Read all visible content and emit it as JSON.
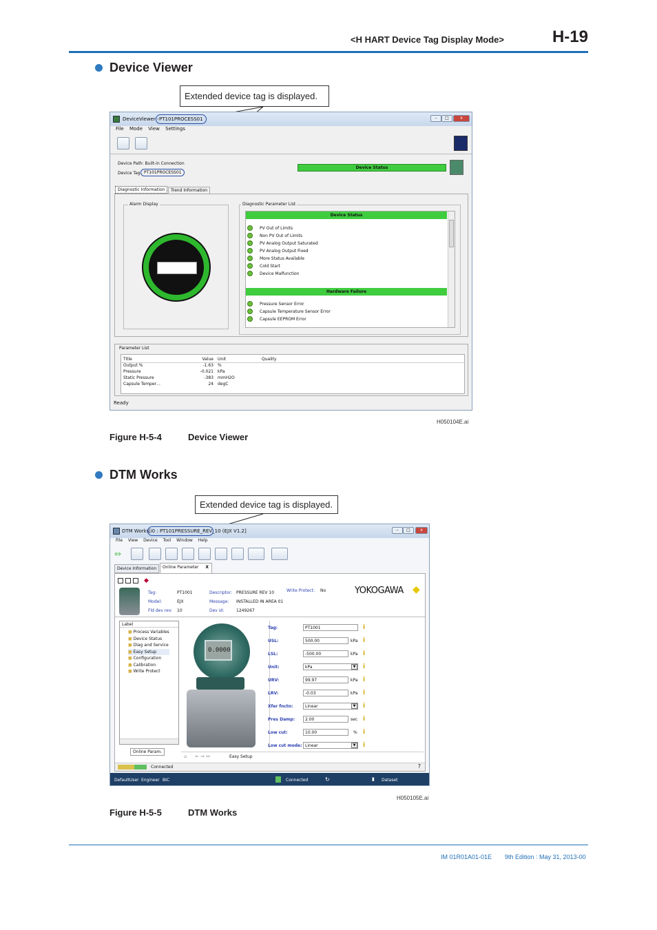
{
  "header": {
    "section": "<H  HART Device Tag Display Mode>",
    "page": "H-19"
  },
  "section1": {
    "title": "Device Viewer",
    "callout": "Extended device tag is displayed.",
    "figure_id": "H050104E.ai",
    "caption_num": "Figure H-5-4",
    "caption_title": "Device Viewer",
    "window": {
      "title_prefix": "DeviceViewer -",
      "title_tag": "PT101PROCESS01",
      "menu": [
        "File",
        "Mode",
        "View",
        "Settings"
      ],
      "device_path": "Device Path: Built-in Connection",
      "device_tag_label": "Device Tag:",
      "device_tag_value": "PT101PROCESS01",
      "device_status": "Device Status",
      "tabs": [
        "Diagnostic Information",
        "Trend Information"
      ],
      "alarm_title": "Alarm Display",
      "diag_title": "Diagnostic Parameter List",
      "group1": "Device Status",
      "group1_items": [
        "PV Out of Limits",
        "Non PV Out of Limits",
        "PV Analog Output Saturated",
        "PV Analog Output Fixed",
        "More Status Available",
        "Cold Start",
        "Device Malfunction"
      ],
      "group2": "Hardware Failure",
      "group2_items": [
        "Pressure Sensor Error",
        "Capsule Temperature Sensor Error",
        "Capsule EEPROM Error"
      ],
      "param_title": "Parameter List",
      "param_headers": [
        "Title",
        "Value",
        "Unit",
        "Quality"
      ],
      "param_rows": [
        [
          "Output %",
          "-1.63",
          "%",
          ""
        ],
        [
          "Pressure",
          "-0.021",
          "kPa",
          ""
        ],
        [
          "Static Pressure",
          "-383",
          "mmH2O",
          ""
        ],
        [
          "Capsule Temper…",
          "24",
          "degC",
          ""
        ]
      ],
      "status": "Ready"
    }
  },
  "section2": {
    "title": "DTM Works",
    "callout": "Extended device tag is displayed.",
    "figure_id": "H050105E.ai",
    "caption_num": "Figure H-5-5",
    "caption_title": "DTM Works",
    "window": {
      "title_prefix": "DTM Works",
      "title_tag": "[i0 : PT101PRESSURE_REV_10 (EJX V1.2]",
      "menu": [
        "File",
        "View",
        "Device",
        "Tool",
        "Window",
        "Help"
      ],
      "tabs": [
        "Device Information",
        "Online Parameter"
      ],
      "tab_close": "X",
      "info": [
        [
          "Tag:",
          "PT1001",
          "Descriptor:",
          "PRESSURE REV 10",
          "Write Protect:",
          "No"
        ],
        [
          "Model:",
          "EJX",
          "Message:",
          "INSTALLED IN AREA 01",
          "",
          ""
        ],
        [
          "Fld dev rev:",
          "10",
          "Dev id:",
          "1249267",
          "",
          ""
        ]
      ],
      "brand": "YOKOGAWA",
      "tree_label": "Label",
      "tree": [
        "Process Variables",
        "Device Status",
        "Diag and Service",
        "Easy Setup",
        "Configuration",
        "Calibration",
        "Write Protect"
      ],
      "tree_tab": "Online Param.",
      "params": [
        {
          "label": "Tag:",
          "value": "PT1001",
          "unit": "",
          "select": false
        },
        {
          "label": "USL:",
          "value": "500.00",
          "unit": "kPa",
          "select": false
        },
        {
          "label": "LSL:",
          "value": "-500.00",
          "unit": "kPa",
          "select": false
        },
        {
          "label": "Unit:",
          "value": "kPa",
          "unit": "",
          "select": true
        },
        {
          "label": "URV:",
          "value": "99.97",
          "unit": "kPa",
          "select": false
        },
        {
          "label": "LRV:",
          "value": "-0.03",
          "unit": "kPa",
          "select": false
        },
        {
          "label": "Xfer fnctn:",
          "value": "Linear",
          "unit": "",
          "select": true
        },
        {
          "label": "Pres Damp:",
          "value": "2.00",
          "unit": "sec",
          "select": false
        },
        {
          "label": "Low cut:",
          "value": "10.00",
          "unit": "%",
          "select": false
        },
        {
          "label": "Low cut mode:",
          "value": "Linear",
          "unit": "",
          "select": true
        }
      ],
      "display_value": "0.0000",
      "bottom_tab": "Easy Setup",
      "status_connected": "Connected",
      "footer": [
        "DefaultUser",
        "Engineer",
        "BIC",
        "Connected",
        "Dataset"
      ]
    }
  },
  "footer": {
    "doc": "IM 01R01A01-01E",
    "edition": "9th Edition : May 31, 2013-00"
  }
}
